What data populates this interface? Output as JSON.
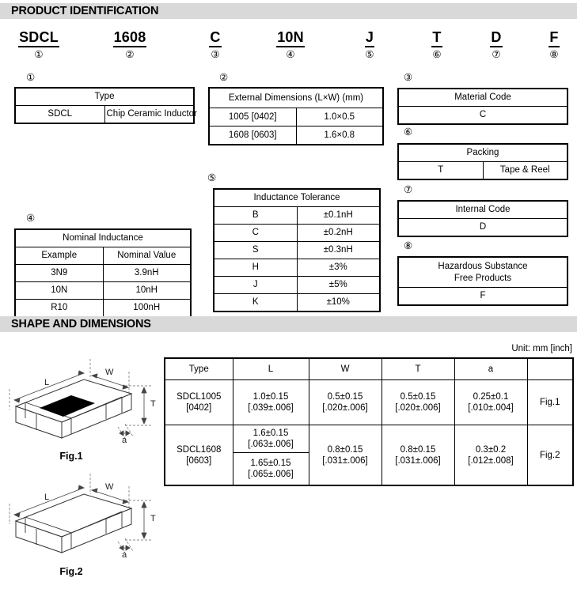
{
  "sections": {
    "product_identification": {
      "title": "PRODUCT IDENTIFICATION"
    },
    "shape_and_dimensions": {
      "title": "SHAPE AND DIMENSIONS"
    }
  },
  "part_number": {
    "segments": [
      {
        "code": "SDCL",
        "marker": "①"
      },
      {
        "code": "1608",
        "marker": "②"
      },
      {
        "code": "C",
        "marker": "③"
      },
      {
        "code": "10N",
        "marker": "④"
      },
      {
        "code": "J",
        "marker": "⑤"
      },
      {
        "code": "T",
        "marker": "⑥"
      },
      {
        "code": "D",
        "marker": "⑦"
      },
      {
        "code": "F",
        "marker": "⑧"
      }
    ]
  },
  "tables": {
    "type": {
      "marker": "①",
      "header": "Type",
      "rows": [
        [
          "SDCL",
          "Chip Ceramic Inductor"
        ]
      ]
    },
    "external_dimensions": {
      "marker": "②",
      "header": "External Dimensions (L×W) (mm)",
      "rows": [
        [
          "1005 [0402]",
          "1.0×0.5"
        ],
        [
          "1608 [0603]",
          "1.6×0.8"
        ]
      ]
    },
    "material_code": {
      "marker": "③",
      "header": "Material Code",
      "rows": [
        [
          "C"
        ]
      ]
    },
    "nominal_inductance": {
      "marker": "④",
      "header": "Nominal Inductance",
      "subheader": [
        "Example",
        "Nominal Value"
      ],
      "rows": [
        [
          "3N9",
          "3.9nH"
        ],
        [
          "10N",
          "10nH"
        ],
        [
          "R10",
          "100nH"
        ]
      ]
    },
    "inductance_tolerance": {
      "marker": "⑤",
      "header": "Inductance Tolerance",
      "rows": [
        [
          "B",
          "±0.1nH"
        ],
        [
          "C",
          "±0.2nH"
        ],
        [
          "S",
          "±0.3nH"
        ],
        [
          "H",
          "±3%"
        ],
        [
          "J",
          "±5%"
        ],
        [
          "K",
          "±10%"
        ]
      ]
    },
    "packing": {
      "marker": "⑥",
      "header": "Packing",
      "rows": [
        [
          "T",
          "Tape & Reel"
        ]
      ]
    },
    "internal_code": {
      "marker": "⑦",
      "header": "Internal Code",
      "rows": [
        [
          "D"
        ]
      ]
    },
    "hazardous_substance": {
      "marker": "⑧",
      "header_line1": "Hazardous Substance",
      "header_line2": "Free Products",
      "rows": [
        [
          "F"
        ]
      ]
    }
  },
  "dimensions": {
    "unit_note": "Unit: mm [inch]",
    "columns": [
      "Type",
      "L",
      "W",
      "T",
      "a",
      ""
    ],
    "rows": [
      {
        "type_line1": "SDCL1005",
        "type_line2": "[0402]",
        "L_mm": "1.0±0.15",
        "L_in": "[.039±.006]",
        "W_mm": "0.5±0.15",
        "W_in": "[.020±.006]",
        "T_mm": "0.5±0.15",
        "T_in": "[.020±.006]",
        "a_mm": "0.25±0.1",
        "a_in": "[.010±.004]",
        "fig": "Fig.1"
      },
      {
        "type_line1": "SDCL1608",
        "type_line2": "[0603]",
        "L_mm": "1.6±0.15",
        "L_in": "[.063±.006]",
        "L2_mm": "1.65±0.15",
        "L2_in": "[.065±.006]",
        "W_mm": "0.8±0.15",
        "W_in": "[.031±.006]",
        "T_mm": "0.8±0.15",
        "T_in": "[.031±.006]",
        "a_mm": "0.3±0.2",
        "a_in": "[.012±.008]",
        "fig": "Fig.2"
      }
    ]
  },
  "figures": [
    {
      "caption": "Fig.1",
      "labels": {
        "L": "L",
        "W": "W",
        "T": "T",
        "a": "a"
      },
      "has_marking": true
    },
    {
      "caption": "Fig.2",
      "labels": {
        "L": "L",
        "W": "W",
        "T": "T",
        "a": "a"
      },
      "has_marking": false
    }
  ],
  "colors": {
    "section_bar": "#d9d9d9",
    "border": "#000000",
    "marking": "#000000",
    "outline": "#555555"
  }
}
